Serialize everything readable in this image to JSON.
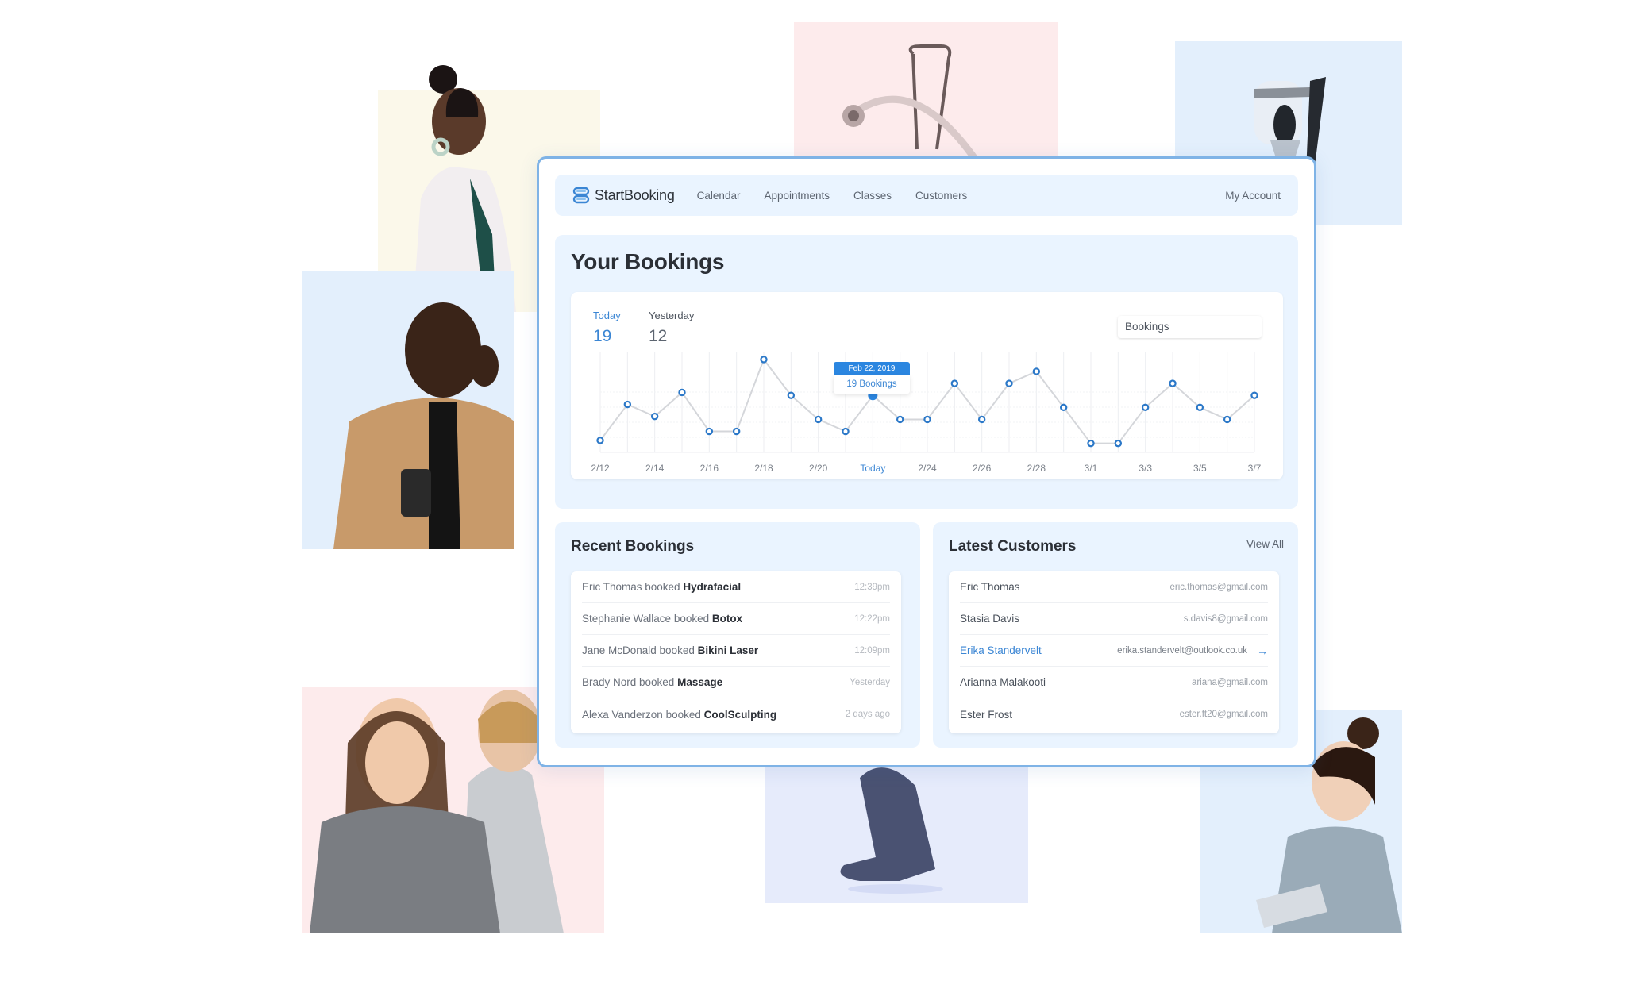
{
  "app": {
    "brand": "StartBooking",
    "nav": [
      "Calendar",
      "Appointments",
      "Classes",
      "Customers"
    ],
    "account": "My Account",
    "accent_color": "#3b86d4",
    "border_color": "#7fb3e6"
  },
  "bookings": {
    "title": "Your Bookings",
    "today_label": "Today",
    "today_value": "19",
    "yesterday_label": "Yesterday",
    "yesterday_value": "12",
    "metric_select": "Bookings",
    "tooltip": {
      "date": "Feb 22, 2019",
      "value": "19 Bookings"
    }
  },
  "chart_data": {
    "type": "line",
    "title": "Your Bookings",
    "xlabel": "",
    "ylabel": "Bookings",
    "x_tick_labels": [
      "2/12",
      "2/14",
      "2/16",
      "2/18",
      "2/20",
      "Today",
      "2/24",
      "2/26",
      "2/28",
      "3/1",
      "3/3",
      "3/5",
      "3/7"
    ],
    "x_tick_every": 2,
    "highlight_label": "Today",
    "highlight_index": 10,
    "values": [
      4,
      16,
      12,
      20,
      7,
      7,
      31,
      19,
      11,
      7,
      19,
      11,
      11,
      23,
      11,
      23,
      27,
      15,
      3,
      3,
      15,
      23,
      15,
      11,
      19
    ],
    "ylim": [
      0,
      36
    ],
    "grid": true,
    "legend": "none"
  },
  "recent": {
    "title": "Recent Bookings",
    "items": [
      {
        "who": "Eric Thomas booked ",
        "service": "Hydrafacial",
        "time": "12:39pm"
      },
      {
        "who": "Stephanie Wallace booked ",
        "service": "Botox",
        "time": "12:22pm"
      },
      {
        "who": "Jane McDonald booked ",
        "service": "Bikini Laser",
        "time": "12:09pm"
      },
      {
        "who": "Brady Nord booked ",
        "service": "Massage",
        "time": "Yesterday"
      },
      {
        "who": "Alexa Vanderzon booked ",
        "service": "CoolSculpting",
        "time": "2 days ago"
      }
    ]
  },
  "customers": {
    "title": "Latest Customers",
    "view_all": "View All",
    "items": [
      {
        "name": "Eric Thomas",
        "email": "eric.thomas@gmail.com"
      },
      {
        "name": "Stasia Davis",
        "email": "s.davis8@gmail.com"
      },
      {
        "name": "Erika Standervelt",
        "email": "erika.standervelt@outlook.co.uk",
        "arrow": "→"
      },
      {
        "name": "Arianna Malakooti",
        "email": "ariana@gmail.com"
      },
      {
        "name": "Ester Frost",
        "email": "ester.ft20@gmail.com"
      }
    ]
  }
}
